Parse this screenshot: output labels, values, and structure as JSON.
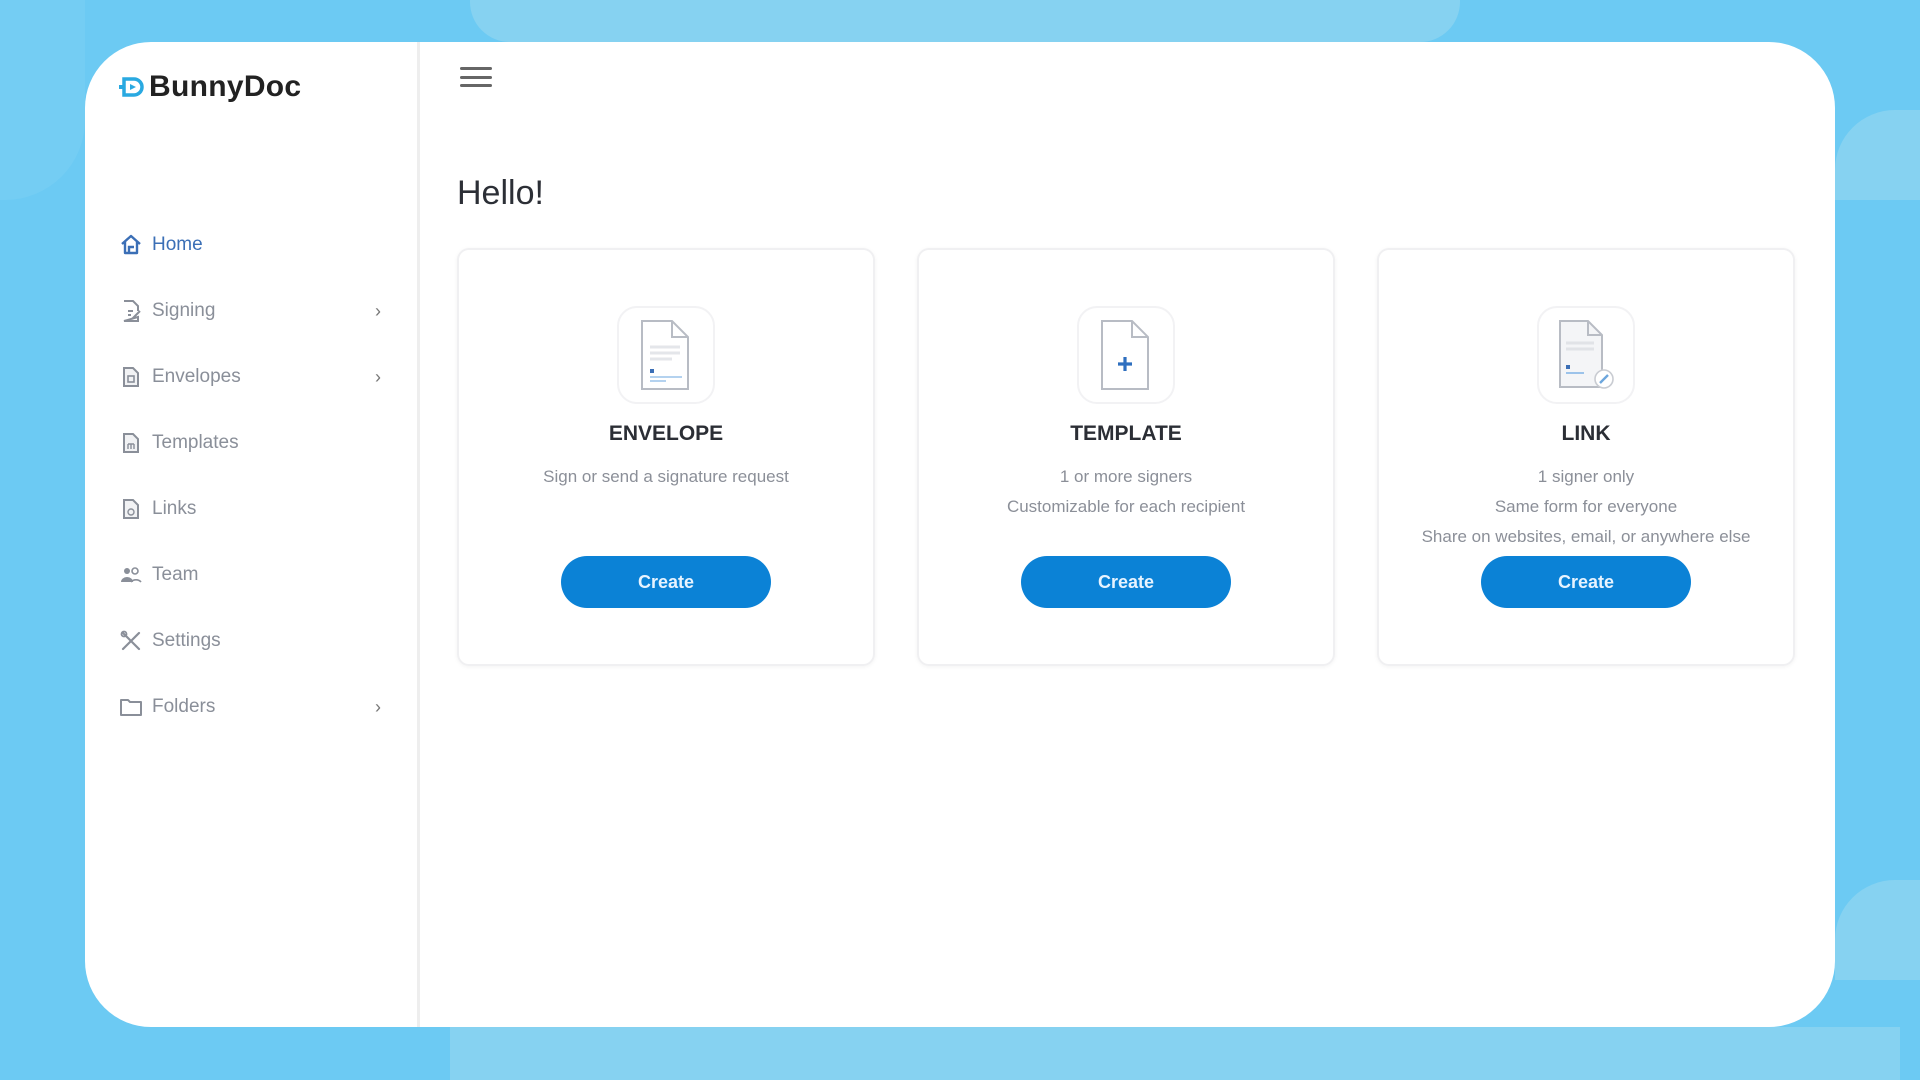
{
  "app": {
    "name": "BunnyDoc",
    "brand_color": "#0b82d6",
    "accent_logo": "#29a9e1"
  },
  "sidebar": {
    "items": [
      {
        "label": "Home",
        "icon": "home-icon",
        "active": true,
        "has_children": false
      },
      {
        "label": "Signing",
        "icon": "signing-icon",
        "active": false,
        "has_children": true
      },
      {
        "label": "Envelopes",
        "icon": "envelope-doc-icon",
        "active": false,
        "has_children": true
      },
      {
        "label": "Templates",
        "icon": "template-doc-icon",
        "active": false,
        "has_children": false
      },
      {
        "label": "Links",
        "icon": "link-doc-icon",
        "active": false,
        "has_children": false
      },
      {
        "label": "Team",
        "icon": "team-icon",
        "active": false,
        "has_children": false
      },
      {
        "label": "Settings",
        "icon": "tools-icon",
        "active": false,
        "has_children": false
      },
      {
        "label": "Folders",
        "icon": "folder-icon",
        "active": false,
        "has_children": true
      }
    ],
    "chevron": "›"
  },
  "main": {
    "greeting": "Hello!",
    "cards": [
      {
        "title": "ENVELOPE",
        "lines": [
          "Sign or send a signature request"
        ],
        "button": "Create",
        "icon": "envelope-document-icon"
      },
      {
        "title": "TEMPLATE",
        "lines": [
          "1 or more signers",
          "Customizable for each recipient"
        ],
        "button": "Create",
        "icon": "new-template-icon"
      },
      {
        "title": "LINK",
        "lines": [
          "1 signer only",
          "Same form for everyone",
          "Share on websites, email, or anywhere else"
        ],
        "button": "Create",
        "icon": "link-document-icon"
      }
    ]
  }
}
